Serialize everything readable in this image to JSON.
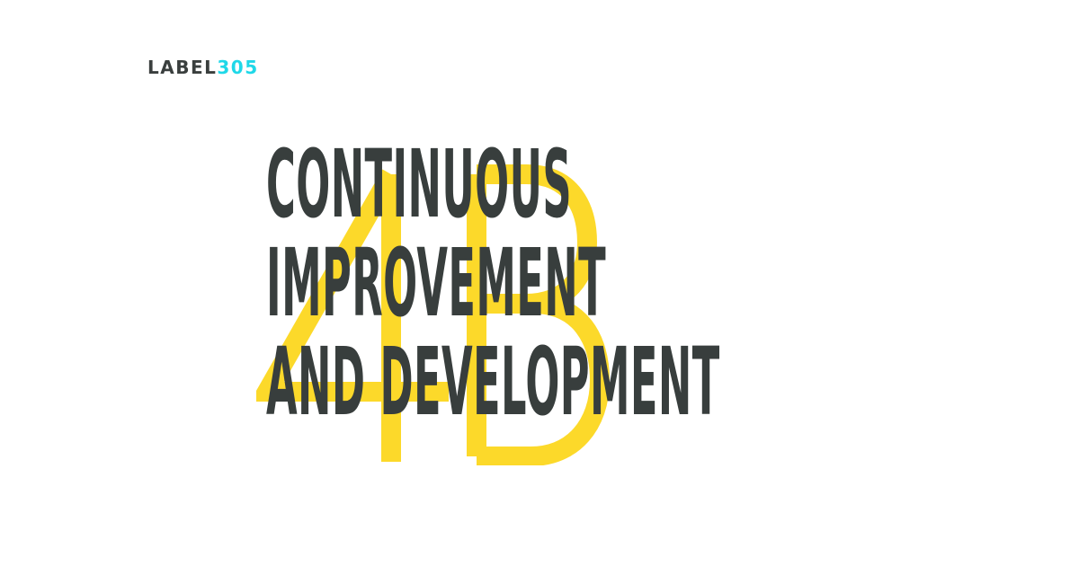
{
  "logo": {
    "word": "LABEL",
    "number": "305",
    "word_color": "#3a3f3e",
    "number_color": "#1fd8e8"
  },
  "background_mark": {
    "text": "4B",
    "color": "#fcd92a"
  },
  "headline": {
    "lines": [
      "CONTINUOUS",
      "IMPROVEMENT",
      "AND DEVELOPMENT"
    ],
    "color": "#383e3d"
  }
}
